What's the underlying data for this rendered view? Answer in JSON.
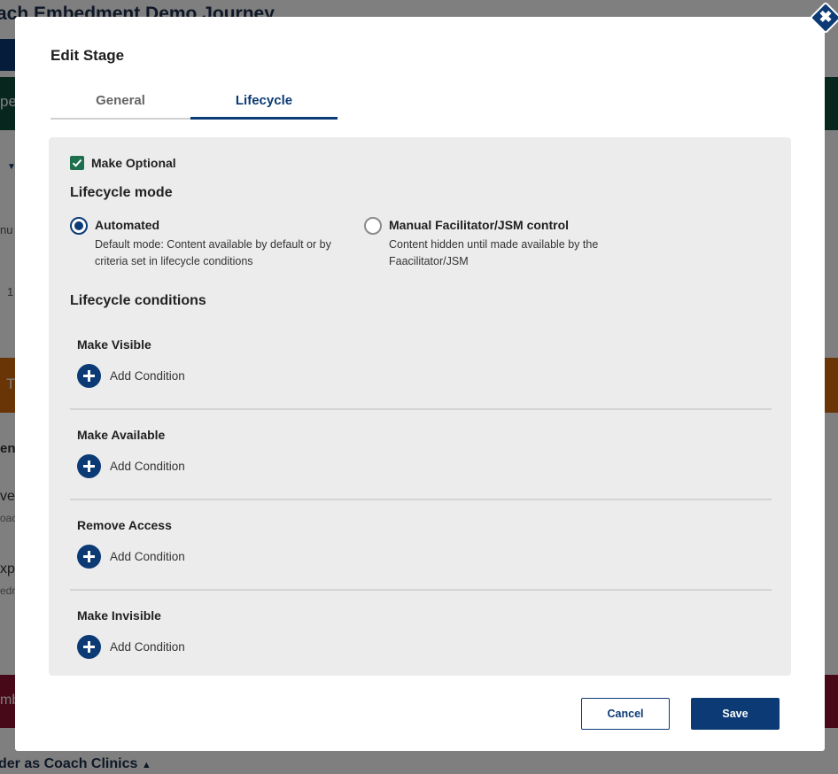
{
  "background": {
    "title": "ach Embedment Demo Journey",
    "green_bar_text": "pe",
    "small1": "nu",
    "small2": "1",
    "orange_bar_text": "T",
    "row_heading": "en",
    "row1_title": "ve",
    "row1_sub": "oac",
    "row2_title": "xp",
    "row2_sub": "edn",
    "red_bar_text": "mb",
    "bottom_text": "der as Coach Clinics"
  },
  "modal": {
    "title": "Edit Stage",
    "close_symbol": "✖",
    "tabs": [
      {
        "label": "General",
        "active": false
      },
      {
        "label": "Lifecycle",
        "active": true
      }
    ],
    "make_optional": {
      "label": "Make Optional",
      "checked": true
    },
    "lifecycle_mode": {
      "heading": "Lifecycle mode",
      "options": [
        {
          "title": "Automated",
          "description": "Default mode: Content available by default or by criteria set in lifecycle conditions",
          "selected": true
        },
        {
          "title": "Manual Facilitator/JSM control",
          "description": "Content hidden until made available by the Faacilitator/JSM",
          "selected": false
        }
      ]
    },
    "lifecycle_conditions": {
      "heading": "Lifecycle conditions",
      "groups": [
        {
          "title": "Make Visible",
          "add_label": "Add Condition"
        },
        {
          "title": "Make Available",
          "add_label": "Add Condition"
        },
        {
          "title": "Remove Access",
          "add_label": "Add Condition"
        },
        {
          "title": "Make Invisible",
          "add_label": "Add Condition"
        }
      ]
    },
    "buttons": {
      "cancel": "Cancel",
      "save": "Save"
    },
    "colors": {
      "primary": "#0b3a75",
      "checkbox": "#1e6f4e",
      "panel": "#ececec"
    }
  }
}
